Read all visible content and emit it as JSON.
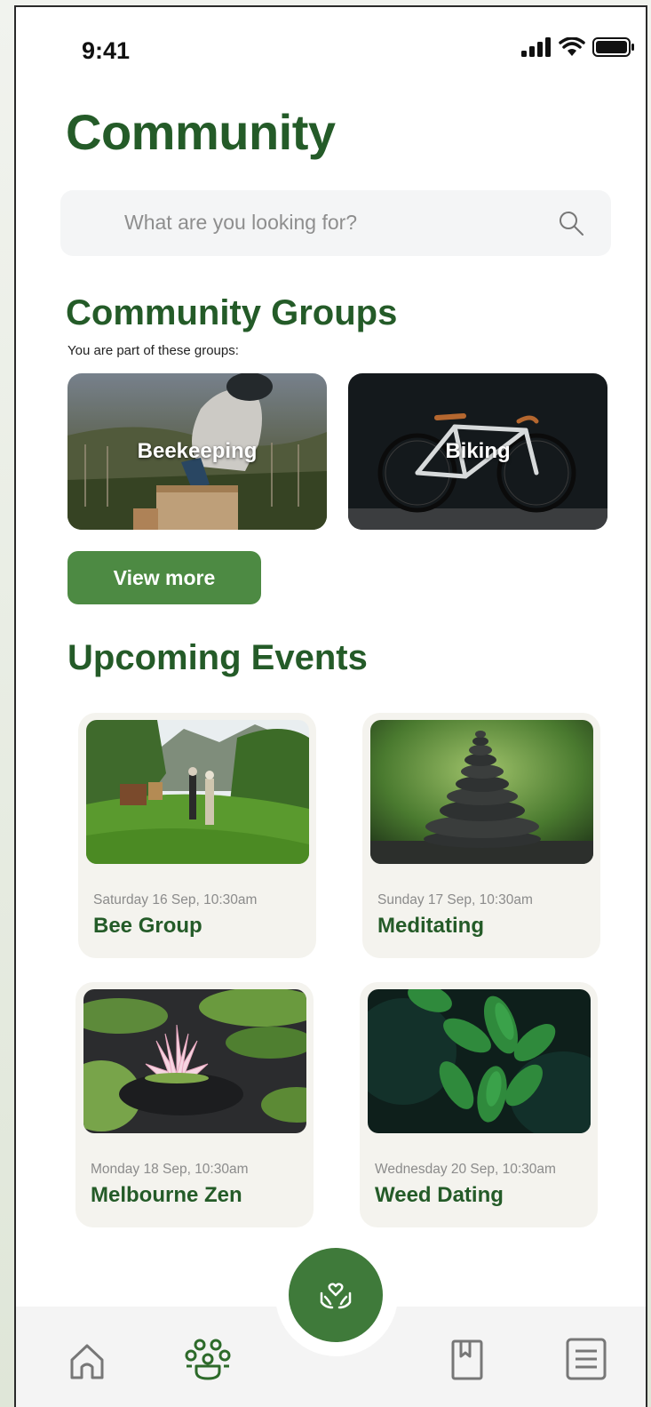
{
  "status_bar": {
    "time": "9:41"
  },
  "page_title": "Community",
  "search": {
    "placeholder": "What are you looking for?"
  },
  "groups": {
    "title": "Community Groups",
    "subtitle": "You are part of these groups:",
    "items": [
      {
        "label": "Beekeeping"
      },
      {
        "label": "Biking"
      }
    ],
    "view_more_label": "View more"
  },
  "events": {
    "title": "Upcoming Events",
    "items": [
      {
        "date": "Saturday 16 Sep, 10:30am",
        "name": "Bee Group"
      },
      {
        "date": "Sunday 17 Sep, 10:30am",
        "name": "Meditating"
      },
      {
        "date": "Monday 18 Sep, 10:30am",
        "name": "Melbourne Zen"
      },
      {
        "date": "Wednesday 20 Sep, 10:30am",
        "name": "Weed Dating"
      }
    ]
  },
  "nav": {
    "items": [
      {
        "icon": "home-icon"
      },
      {
        "icon": "community-icon",
        "active": true
      },
      {
        "icon": "hands-heart-icon"
      },
      {
        "icon": "bookmark-icon"
      },
      {
        "icon": "document-icon"
      }
    ]
  },
  "colors": {
    "brand_green": "#245b28",
    "button_green": "#4d8a43",
    "fab_green": "#3f7a3a"
  }
}
